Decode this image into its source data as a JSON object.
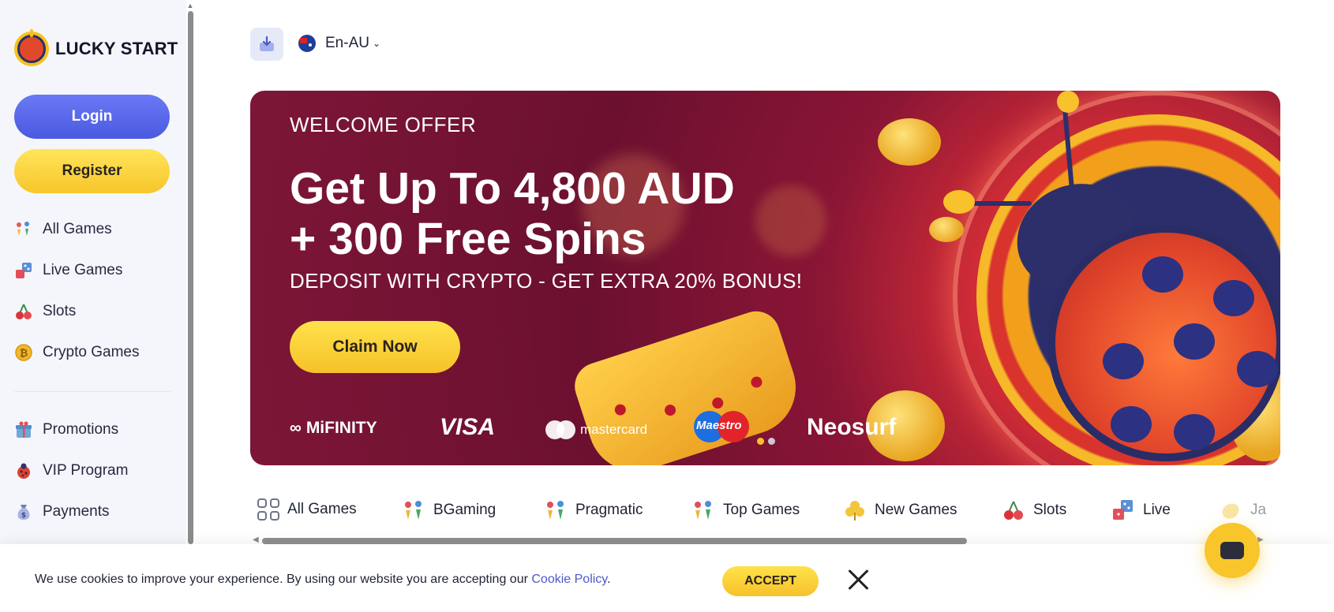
{
  "sidebar": {
    "logo_text": "LUCKY START",
    "login_label": "Login",
    "register_label": "Register",
    "nav_primary": [
      {
        "label": "All Games",
        "icon": "all-games-icon"
      },
      {
        "label": "Live Games",
        "icon": "live-games-icon"
      },
      {
        "label": "Slots",
        "icon": "cherries-icon"
      },
      {
        "label": "Crypto Games",
        "icon": "bitcoin-icon"
      }
    ],
    "nav_secondary": [
      {
        "label": "Promotions",
        "icon": "gift-icon"
      },
      {
        "label": "VIP Program",
        "icon": "ladybug-icon"
      },
      {
        "label": "Payments",
        "icon": "money-bag-icon"
      }
    ]
  },
  "topbar": {
    "language": "En-AU"
  },
  "banner": {
    "eyebrow": "WELCOME OFFER",
    "headline_line1": "Get Up To 4,800 AUD",
    "headline_line2": "+ 300 Free Spins",
    "subline": "DEPOSIT WITH CRYPTO - GET EXTRA 20% BONUS!",
    "cta_label": "Claim Now",
    "payment_methods": {
      "mifinity": "MiFINITY",
      "visa": "VISA",
      "mastercard": "mastercard",
      "maestro": "Maestro",
      "neosurf": "Neosurf"
    }
  },
  "categories": [
    {
      "label": "All Games",
      "icon": "grid-icon"
    },
    {
      "label": "BGaming",
      "icon": "cards-icon"
    },
    {
      "label": "Pragmatic",
      "icon": "cards-icon"
    },
    {
      "label": "Top Games",
      "icon": "cards-icon"
    },
    {
      "label": "New Games",
      "icon": "clover-icon"
    },
    {
      "label": "Slots",
      "icon": "cherries-icon"
    },
    {
      "label": "Live",
      "icon": "dice-icon"
    },
    {
      "label": "Ja",
      "icon": "lemon-icon"
    }
  ],
  "cookie": {
    "text": "We use cookies to improve your experience. By using our website you are accepting our ",
    "link": "Cookie Policy",
    "suffix": ".",
    "accept_label": "ACCEPT"
  },
  "colors": {
    "primary_blue": "#5563e8",
    "accent_yellow": "#f7c52a",
    "banner_red": "#7d1637"
  }
}
